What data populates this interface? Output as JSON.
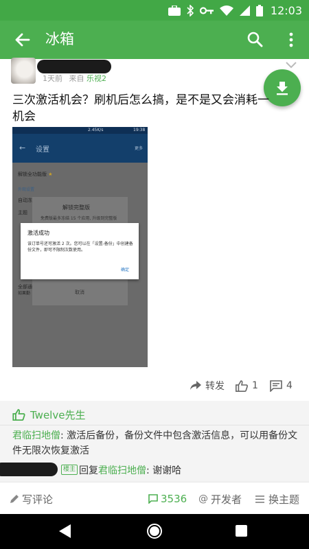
{
  "status_bar": {
    "time": "12:03"
  },
  "app_bar": {
    "title": "冰箱"
  },
  "post": {
    "time": "1天前",
    "source_prefix": "来自",
    "device": "乐视2",
    "text": "三次激活机会？刷机后怎么搞，是不是又会消耗一机会"
  },
  "embedded_screenshot": {
    "status_speed": "2.45K/s",
    "status_time": "19:38",
    "title": "设置",
    "more": "更多",
    "row_unlock": "解锁全功能版",
    "section": "外观设置",
    "row_auto": "自动冻结",
    "row_theme": "主题",
    "row_all": "全部通",
    "row_all_sub": "如果勤",
    "dialog1_title": "解锁完整版",
    "dialog1_body": "免费版最多冻结 15 个应用, 升级到完整版",
    "dialog1_cancel": "取消",
    "dialog2_title": "激活成功",
    "dialog2_body": "该订单号还可激活 2 次。您可以在「设置-备份」中创建备份文件，即可不限制次数使用。",
    "dialog2_ok": "确定"
  },
  "actions": {
    "forward": "转发",
    "likes": "1",
    "comments": "4"
  },
  "replies": {
    "liked_by": "Twelve先生",
    "reply1_user": "君临扫地僧",
    "reply1_text": ": 激活后备份，备份文件中包含激活信息，可以用备份文件无限次恢复激活",
    "reply2_badge": "楼主",
    "reply2_prefix": "回复",
    "reply2_user": "君临扫地僧",
    "reply2_text": ": 谢谢哈"
  },
  "bottom_bar": {
    "write_comment": "写评论",
    "comment_count": "3536",
    "developer": "开发者",
    "theme": "换主题"
  },
  "colors": {
    "accent": "#4caf50",
    "status": "#42a846"
  }
}
